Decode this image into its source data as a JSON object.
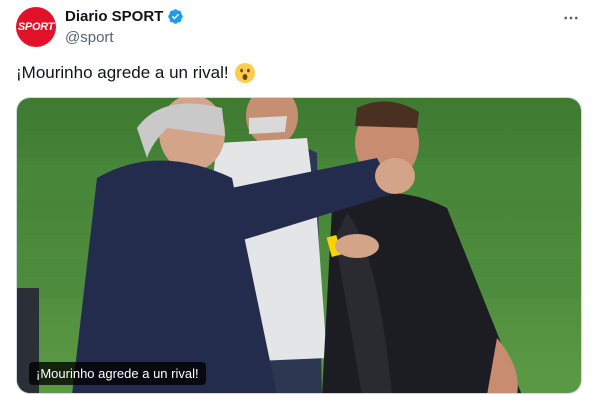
{
  "account": {
    "display_name": "Diario SPORT",
    "handle": "@sport",
    "avatar_text": "SPORT",
    "verified": true,
    "brand_color": "#e2112a"
  },
  "tweet": {
    "text": "¡Mourinho agrede a un rival!",
    "emoji": "astonished-face-emoji"
  },
  "media": {
    "caption": "¡Mourinho agrede a un rival!"
  },
  "icons": {
    "verified": "verified-badge-icon",
    "more": "more-options-icon"
  },
  "colors": {
    "verified_blue": "#1d9bf0",
    "text": "#0f1419",
    "secondary_text": "#536471",
    "pitch_green": "#4f8a3a"
  }
}
